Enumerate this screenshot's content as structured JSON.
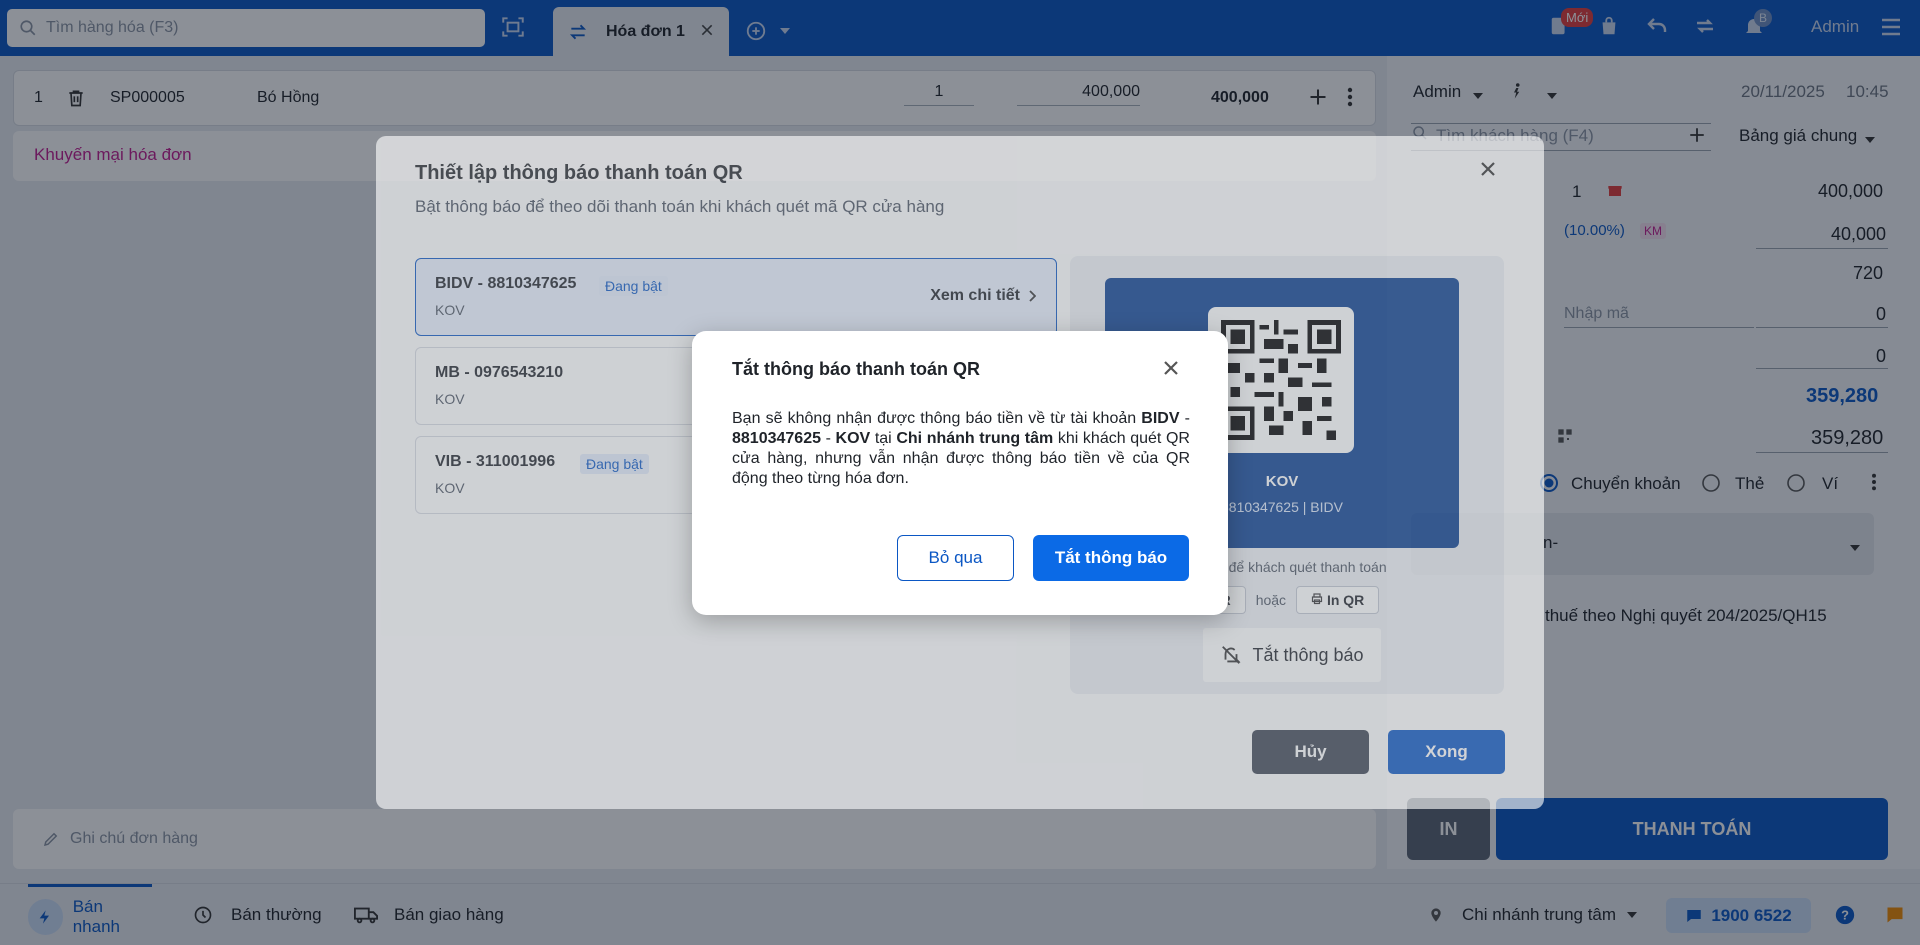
{
  "topbar": {
    "search_placeholder": "Tìm hàng hóa (F3)",
    "tab_label": "Hóa đơn 1",
    "new_badge": "Mới",
    "notif_badge": "B",
    "user": "Admin"
  },
  "cart": {
    "row": {
      "index": "1",
      "code": "SP000005",
      "name": "Bó Hồng",
      "qty": "1",
      "price": "400,000",
      "total": "400,000"
    },
    "promo_label": "Khuyến mại hóa đơn",
    "note_placeholder": "Ghi chú đơn hàng"
  },
  "right_panel": {
    "seller": "Admin",
    "date": "20/11/2025",
    "time": "10:45",
    "customer_placeholder": "Tìm khách hàng (F4)",
    "price_list": "Bảng giá chung",
    "qty": "1",
    "subtotal": "400,000",
    "discount_pct": "(10.00%)",
    "km": "KM",
    "discount": "40,000",
    "other": "720",
    "coupon_placeholder": "Nhập mã",
    "coupon_value": "0",
    "extra": "0",
    "total": "359,280",
    "paid": "359,280",
    "method_transfer": "Chuyển khoản",
    "method_card": "Thẻ",
    "method_wallet": "Ví",
    "account_dd": "n-",
    "tax_note": "thuế theo Nghị quyết 204/2025/QH15",
    "print_btn": "IN",
    "pay_btn": "THANH TOÁN"
  },
  "bottom": {
    "mode_fast": "Bán nhanh",
    "mode_normal": "Bán thường",
    "mode_delivery": "Bán giao hàng",
    "branch": "Chi nhánh trung tâm",
    "hotline": "1900 6522"
  },
  "qr_modal": {
    "title": "Thiết lập thông báo thanh toán QR",
    "subtitle": "Bật thông báo để theo dõi thanh toán khi khách quét mã QR cửa hàng",
    "accounts": [
      {
        "name": "BIDV - 8810347625",
        "owner": "KOV",
        "status": "Đang bật",
        "detail": "Xem chi tiết"
      },
      {
        "name": "MB - 0976543210",
        "owner": "KOV"
      },
      {
        "name": "VIB - 311001996",
        "owner": "KOV",
        "status": "Đang bật"
      }
    ],
    "qr_name": "KOV",
    "qr_account": "8810347625 | BIDV",
    "qr_hint": "i quầy để khách quét thanh toán",
    "qr_btn_left": "QR",
    "qr_or": "hoặc",
    "qr_btn_print": "In QR",
    "turn_off": "Tắt thông báo",
    "cancel": "Hủy",
    "done": "Xong"
  },
  "confirm": {
    "title": "Tắt thông báo thanh toán QR",
    "body_1": "Bạn sẽ không nhận được thông báo tiền về từ tài khoản",
    "bank": "BIDV",
    "sep1": "-",
    "account_no": "8810347625",
    "sep2": "-",
    "owner": "KOV",
    "at": "tại",
    "branch": "Chi nhánh trung tâm",
    "body_2": "khi khách quét QR cửa hàng, nhưng vẫn nhận được thông báo tiền về của QR động theo từng hóa đơn.",
    "skip": "Bỏ qua",
    "confirm": "Tắt thông báo"
  }
}
